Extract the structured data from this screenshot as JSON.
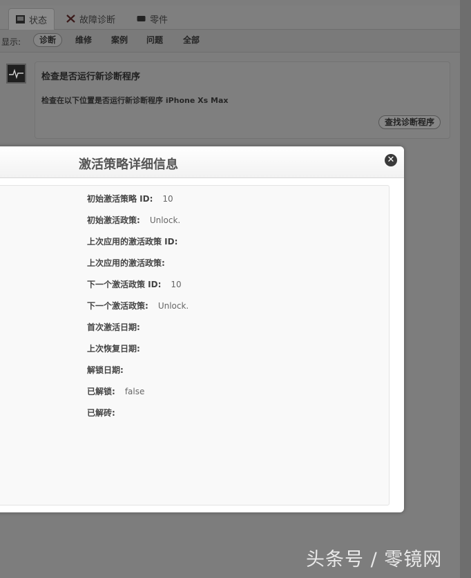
{
  "tabs": [
    {
      "label": "状态",
      "icon": "status-icon",
      "active": true
    },
    {
      "label": "故障诊断",
      "icon": "tools-icon",
      "active": false
    },
    {
      "label": "零件",
      "icon": "parts-icon",
      "active": false
    }
  ],
  "filter": {
    "label": "显示:",
    "items": [
      "诊断",
      "维修",
      "案例",
      "问题",
      "全部"
    ],
    "active": "诊断"
  },
  "card": {
    "title": "检查是否运行新诊断程序",
    "description": "检查在以下位置是否运行新诊断程序 iPhone Xs Max",
    "button": "查找诊断程序"
  },
  "modal": {
    "title": "激活策略详细信息",
    "close_icon": "close-icon",
    "fields": [
      {
        "label": "初始激活策略 ID:",
        "value": "10"
      },
      {
        "label": "初始激活政策:",
        "value": "Unlock."
      },
      {
        "label": "上次应用的激活政策 ID:",
        "value": ""
      },
      {
        "label": "上次应用的激活政策:",
        "value": ""
      },
      {
        "label": "下一个激活政策 ID:",
        "value": "10"
      },
      {
        "label": "下一个激活政策:",
        "value": "Unlock."
      },
      {
        "label": "首次激活日期:",
        "value": ""
      },
      {
        "label": "上次恢复日期:",
        "value": ""
      },
      {
        "label": "解锁日期:",
        "value": ""
      },
      {
        "label": "已解锁:",
        "value": "false"
      },
      {
        "label": "已解砖:",
        "value": ""
      }
    ]
  },
  "watermark": "头条号 / 零镜网"
}
